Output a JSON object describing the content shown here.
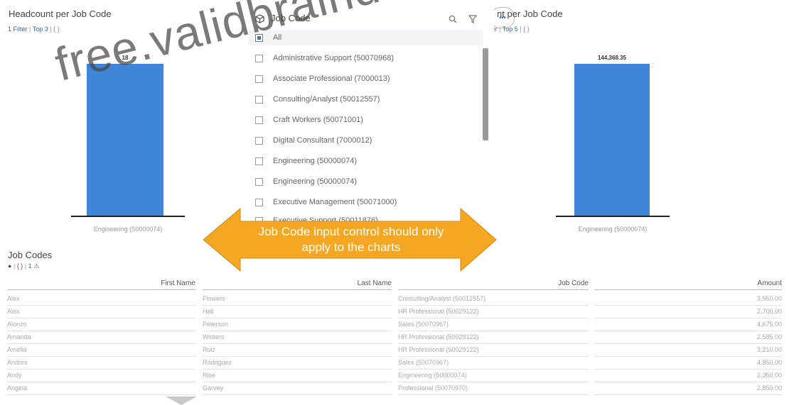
{
  "left_chart": {
    "title": "Headcount per Job Code",
    "filter_label": "1 Filter",
    "top_label": "Top 3",
    "braces": "{ }",
    "bar_value": "18",
    "category": "Engineering (50000074)"
  },
  "right_chart": {
    "title": "Headcount per Job Code",
    "filter_label": "1 Filter",
    "top_label": "Top 5",
    "braces": "{ }",
    "bar_value": "144,368.35",
    "category": "Engineering (50000074)"
  },
  "dropdown": {
    "title": "Job Code",
    "more_label": "•••",
    "items": [
      "All",
      "Administrative Support (50070968)",
      "Associate Professional (7000013)",
      "Consulting/Analyst (50012557)",
      "Craft Workers (50071001)",
      "Digital Consultant (7000012)",
      "Engineering (50000074)",
      "Engineering (50000074)",
      "Executive Management (50071000)",
      "Executive Support (50011876)"
    ]
  },
  "callout": {
    "line1": "Job Code input control should only",
    "line2": "apply to the charts",
    "color": "#f5a623"
  },
  "table_widget": {
    "title": "Job Codes",
    "braces": "{ }",
    "count": "1"
  },
  "table": {
    "columns": [
      "First Name",
      "Last Name",
      "Job Code",
      "Amount"
    ],
    "rows": [
      [
        "Alex",
        "Flowers",
        "Consulting/Analyst (50012557)",
        "3,550.00"
      ],
      [
        "Alex",
        "Hall",
        "HR Professional (50029122)",
        "2,700.00"
      ],
      [
        "Alonzo",
        "Peterson",
        "Sales (50070967)",
        "4,675.00"
      ],
      [
        "Amanda",
        "Winters",
        "HR Professional (50029122)",
        "2,585.00"
      ],
      [
        "Amelia",
        "Ruiz",
        "HR Professional (50029122)",
        "3,210.00"
      ],
      [
        "Andres",
        "Rodriguez",
        "Sales (50070967)",
        "4,850.00"
      ],
      [
        "Andy",
        "Rise",
        "Engineering (50000074)",
        "2,350.00"
      ],
      [
        "Angela",
        "Garvey",
        "Professional (50070970)",
        "2,850.00"
      ]
    ]
  },
  "watermark": "free.validbraindumps.com"
}
